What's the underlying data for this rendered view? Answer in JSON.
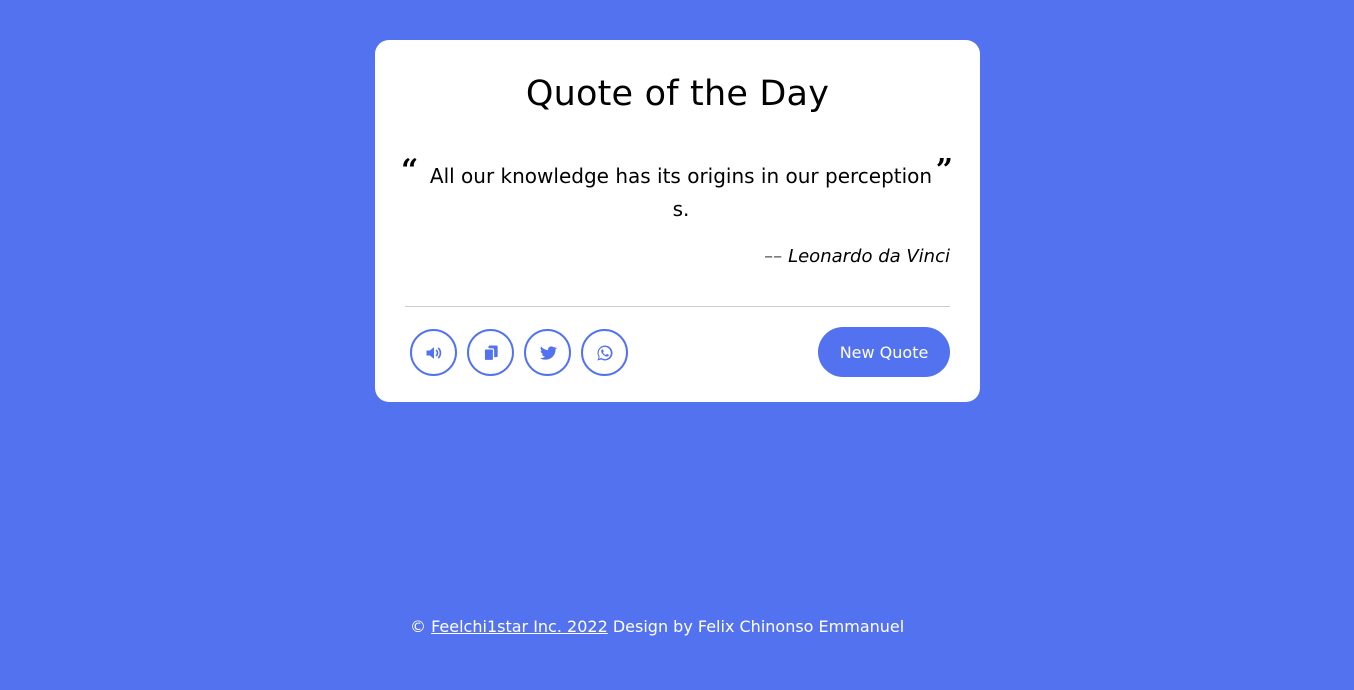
{
  "card": {
    "title": "Quote of the Day",
    "quote_open_mark": "“",
    "quote_close_mark": "”",
    "quote": "All our knowledge has its origins in our perceptions.",
    "author_dash": "––",
    "author": "Leonardo da Vinci",
    "new_quote_label": "New Quote"
  },
  "actions": [
    {
      "icon": "speaker-icon"
    },
    {
      "icon": "copy-icon"
    },
    {
      "icon": "twitter-icon"
    },
    {
      "icon": "whatsapp-icon"
    }
  ],
  "footer": {
    "copyright_symbol": "©",
    "link_text": "Feelchi1star Inc. 2022",
    "credit": "Design by Felix Chinonso Emmanuel"
  },
  "colors": {
    "background": "#5372f0",
    "card": "#ffffff",
    "accent": "#5372f0"
  }
}
